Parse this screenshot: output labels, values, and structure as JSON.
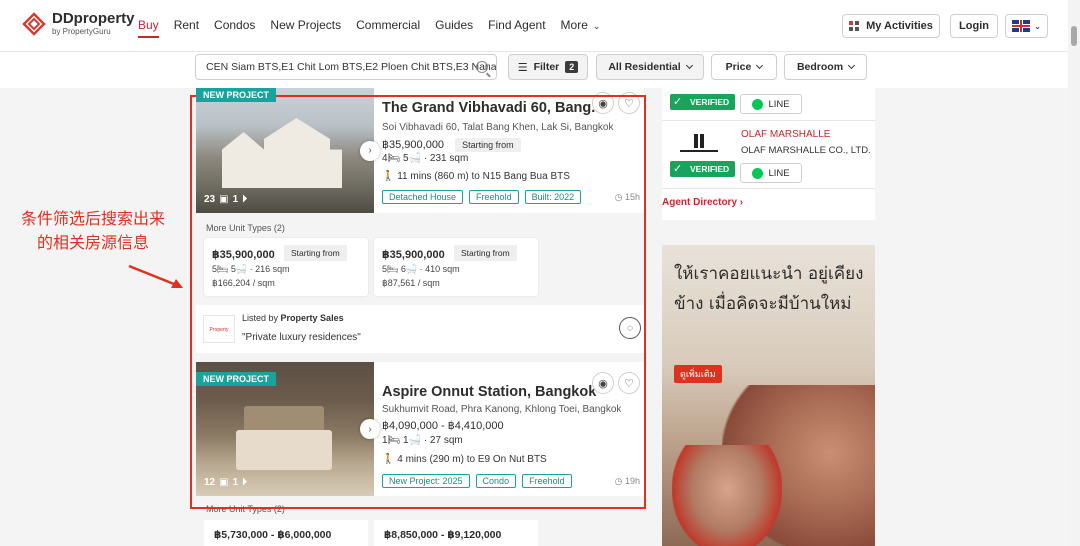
{
  "header": {
    "logo_main": "DDproperty",
    "logo_sub": "by PropertyGuru",
    "nav": [
      {
        "label": "Buy"
      },
      {
        "label": "Rent"
      },
      {
        "label": "Condos"
      },
      {
        "label": "New Projects"
      },
      {
        "label": "Commercial"
      },
      {
        "label": "Guides"
      },
      {
        "label": "Find Agent"
      },
      {
        "label": "More"
      }
    ],
    "my_activities": "My Activities",
    "login": "Login"
  },
  "search": {
    "value": "CEN Siam BTS,E1 Chit Lom BTS,E2 Ploen Chit BTS,E3 Nana",
    "filter_label": "Filter",
    "filter_count": "2",
    "type_label": "All Residential",
    "price_label": "Price",
    "bedroom_label": "Bedroom"
  },
  "annotation": {
    "line1": "条件筛选后搜索出来",
    "line2": "的相关房源信息"
  },
  "listing1": {
    "tag": "NEW PROJECT",
    "title": "The Grand Vibhavadi 60, Bang...",
    "address": "Soi Vibhavadi 60, Talat Bang Khen, Lak Si, Bangkok",
    "price": "฿35,900,000",
    "price_note": "Starting from",
    "specs": "4🛏  5🛁  ·  231 sqm",
    "walk": "11 mins (860 m) to N15 Bang Bua BTS",
    "tags": [
      "Detached House",
      "Freehold",
      "Built: 2022"
    ],
    "time": "15h",
    "image_count": "23",
    "video_count": "1",
    "more_units_label": "More Unit Types (2)",
    "units": [
      {
        "price": "฿35,900,000",
        "note": "Starting from",
        "specs": "5🛏  5🛁  ·  216 sqm",
        "psqm": "฿166,204 / sqm"
      },
      {
        "price": "฿35,900,000",
        "note": "Starting from",
        "specs": "5🛏  6🛁  ·  410 sqm",
        "psqm": "฿87,561 / sqm"
      }
    ],
    "listed_by_prefix": "Listed by",
    "listed_by": "Property Sales",
    "quote": "\"Private luxury residences\""
  },
  "listing2": {
    "tag": "NEW PROJECT",
    "title": "Aspire Onnut Station, Bangkok",
    "address": "Sukhumvit Road, Phra Kanong, Khlong Toei, Bangkok",
    "price": "฿4,090,000 - ฿4,410,000",
    "specs": "1🛏  1🛁  ·  27 sqm",
    "walk": "4 mins (290 m) to E9 On Nut BTS",
    "tags": [
      "New Project: 2025",
      "Condo",
      "Freehold"
    ],
    "time": "19h",
    "image_count": "12",
    "video_count": "1",
    "more_units_label": "More Unit Types (2)",
    "units": [
      {
        "price": "฿5,730,000 - ฿6,000,000"
      },
      {
        "price": "฿8,850,000 - ฿9,120,000"
      }
    ]
  },
  "sidebar": {
    "verified": "VERIFIED",
    "line": "LINE",
    "agent_name": "OLAF MARSHALLE",
    "agent_company": "OLAF MARSHALLE CO., LTD.",
    "agent_directory": "Agent Directory",
    "ad_text": "ให้เราคอยแนะนำ อยู่เคียงข้าง เมื่อคิดจะมีบ้านใหม่",
    "ad_button": "ดูเพิ่มเติม"
  }
}
